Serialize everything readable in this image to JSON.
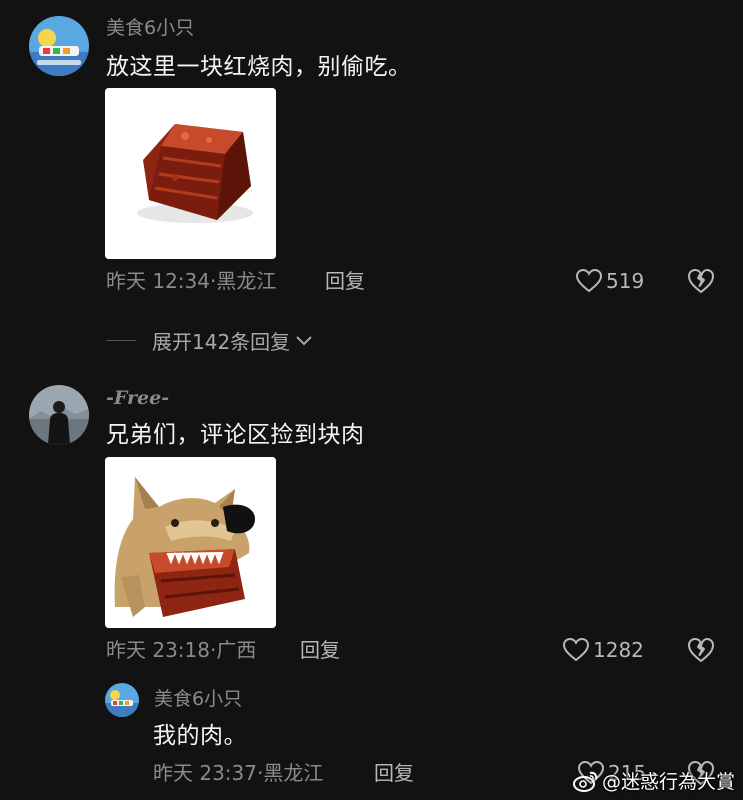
{
  "comments": [
    {
      "username": "美食6小只",
      "text": "放这里一块红烧肉，别偷吃。",
      "time": "昨天 12:34",
      "sep": "·",
      "location": "黑龙江",
      "reply_label": "回复",
      "likes": "519",
      "sticker": "braised-pork"
    },
    {
      "username": "-Free-",
      "text": "兄弟们，评论区捡到块肉",
      "time": "昨天 23:18",
      "sep": "·",
      "location": "广西",
      "reply_label": "回复",
      "likes": "1282",
      "sticker": "dog-with-pork"
    }
  ],
  "expand_replies": {
    "label": "展开142条回复"
  },
  "nested_reply": {
    "username": "美食6小只",
    "text": "我的肉。",
    "time": "昨天 23:37",
    "sep": "·",
    "location": "黑龙江",
    "reply_label": "回复",
    "likes": "215"
  },
  "watermark": {
    "text": "@迷惑行為大賞"
  },
  "colors": {
    "background": "#121212",
    "muted_text": "#8a8a8a",
    "primary_text": "#f4f4f4"
  }
}
